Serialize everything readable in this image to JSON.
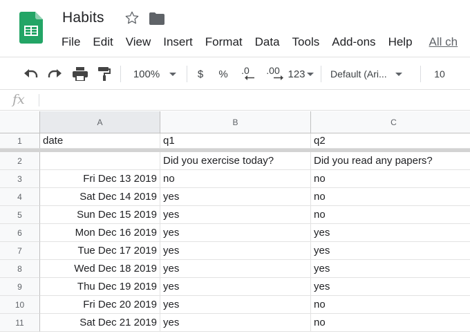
{
  "app": {
    "title": "Habits",
    "logo_icon": "google-sheets-logo",
    "brand_color": "#23a566"
  },
  "menu": [
    {
      "label": "File"
    },
    {
      "label": "Edit"
    },
    {
      "label": "View"
    },
    {
      "label": "Insert"
    },
    {
      "label": "Format"
    },
    {
      "label": "Data"
    },
    {
      "label": "Tools"
    },
    {
      "label": "Add-ons"
    },
    {
      "label": "Help"
    }
  ],
  "menu_link": "All ch",
  "toolbar": {
    "zoom": "100%",
    "currency": "$",
    "percent": "%",
    "decrease_decimal": ".0",
    "increase_decimal": ".00",
    "number_format": "123",
    "font": "Default (Ari...",
    "font_size": "10"
  },
  "formula_bar": {
    "label": "fx",
    "value": ""
  },
  "sheet": {
    "columns": [
      "A",
      "B",
      "C"
    ],
    "selected_column": "A",
    "rows": [
      {
        "num": "1",
        "a": "date",
        "b": "q1",
        "c": "q2"
      },
      {
        "num": "2",
        "a": "",
        "b": "Did you exercise today?",
        "c": "Did you read any papers?"
      },
      {
        "num": "3",
        "a": "Fri Dec 13 2019",
        "b": "no",
        "c": "no"
      },
      {
        "num": "4",
        "a": "Sat Dec 14 2019",
        "b": "yes",
        "c": "no"
      },
      {
        "num": "5",
        "a": "Sun Dec 15 2019",
        "b": "yes",
        "c": "no"
      },
      {
        "num": "6",
        "a": "Mon Dec 16 2019",
        "b": "yes",
        "c": "yes"
      },
      {
        "num": "7",
        "a": "Tue Dec 17 2019",
        "b": "yes",
        "c": "yes"
      },
      {
        "num": "8",
        "a": "Wed Dec 18 2019",
        "b": "yes",
        "c": "yes"
      },
      {
        "num": "9",
        "a": "Thu Dec 19 2019",
        "b": "yes",
        "c": "yes"
      },
      {
        "num": "10",
        "a": "Fri Dec 20 2019",
        "b": "yes",
        "c": "no"
      },
      {
        "num": "11",
        "a": "Sat Dec 21 2019",
        "b": "yes",
        "c": "no"
      }
    ]
  }
}
